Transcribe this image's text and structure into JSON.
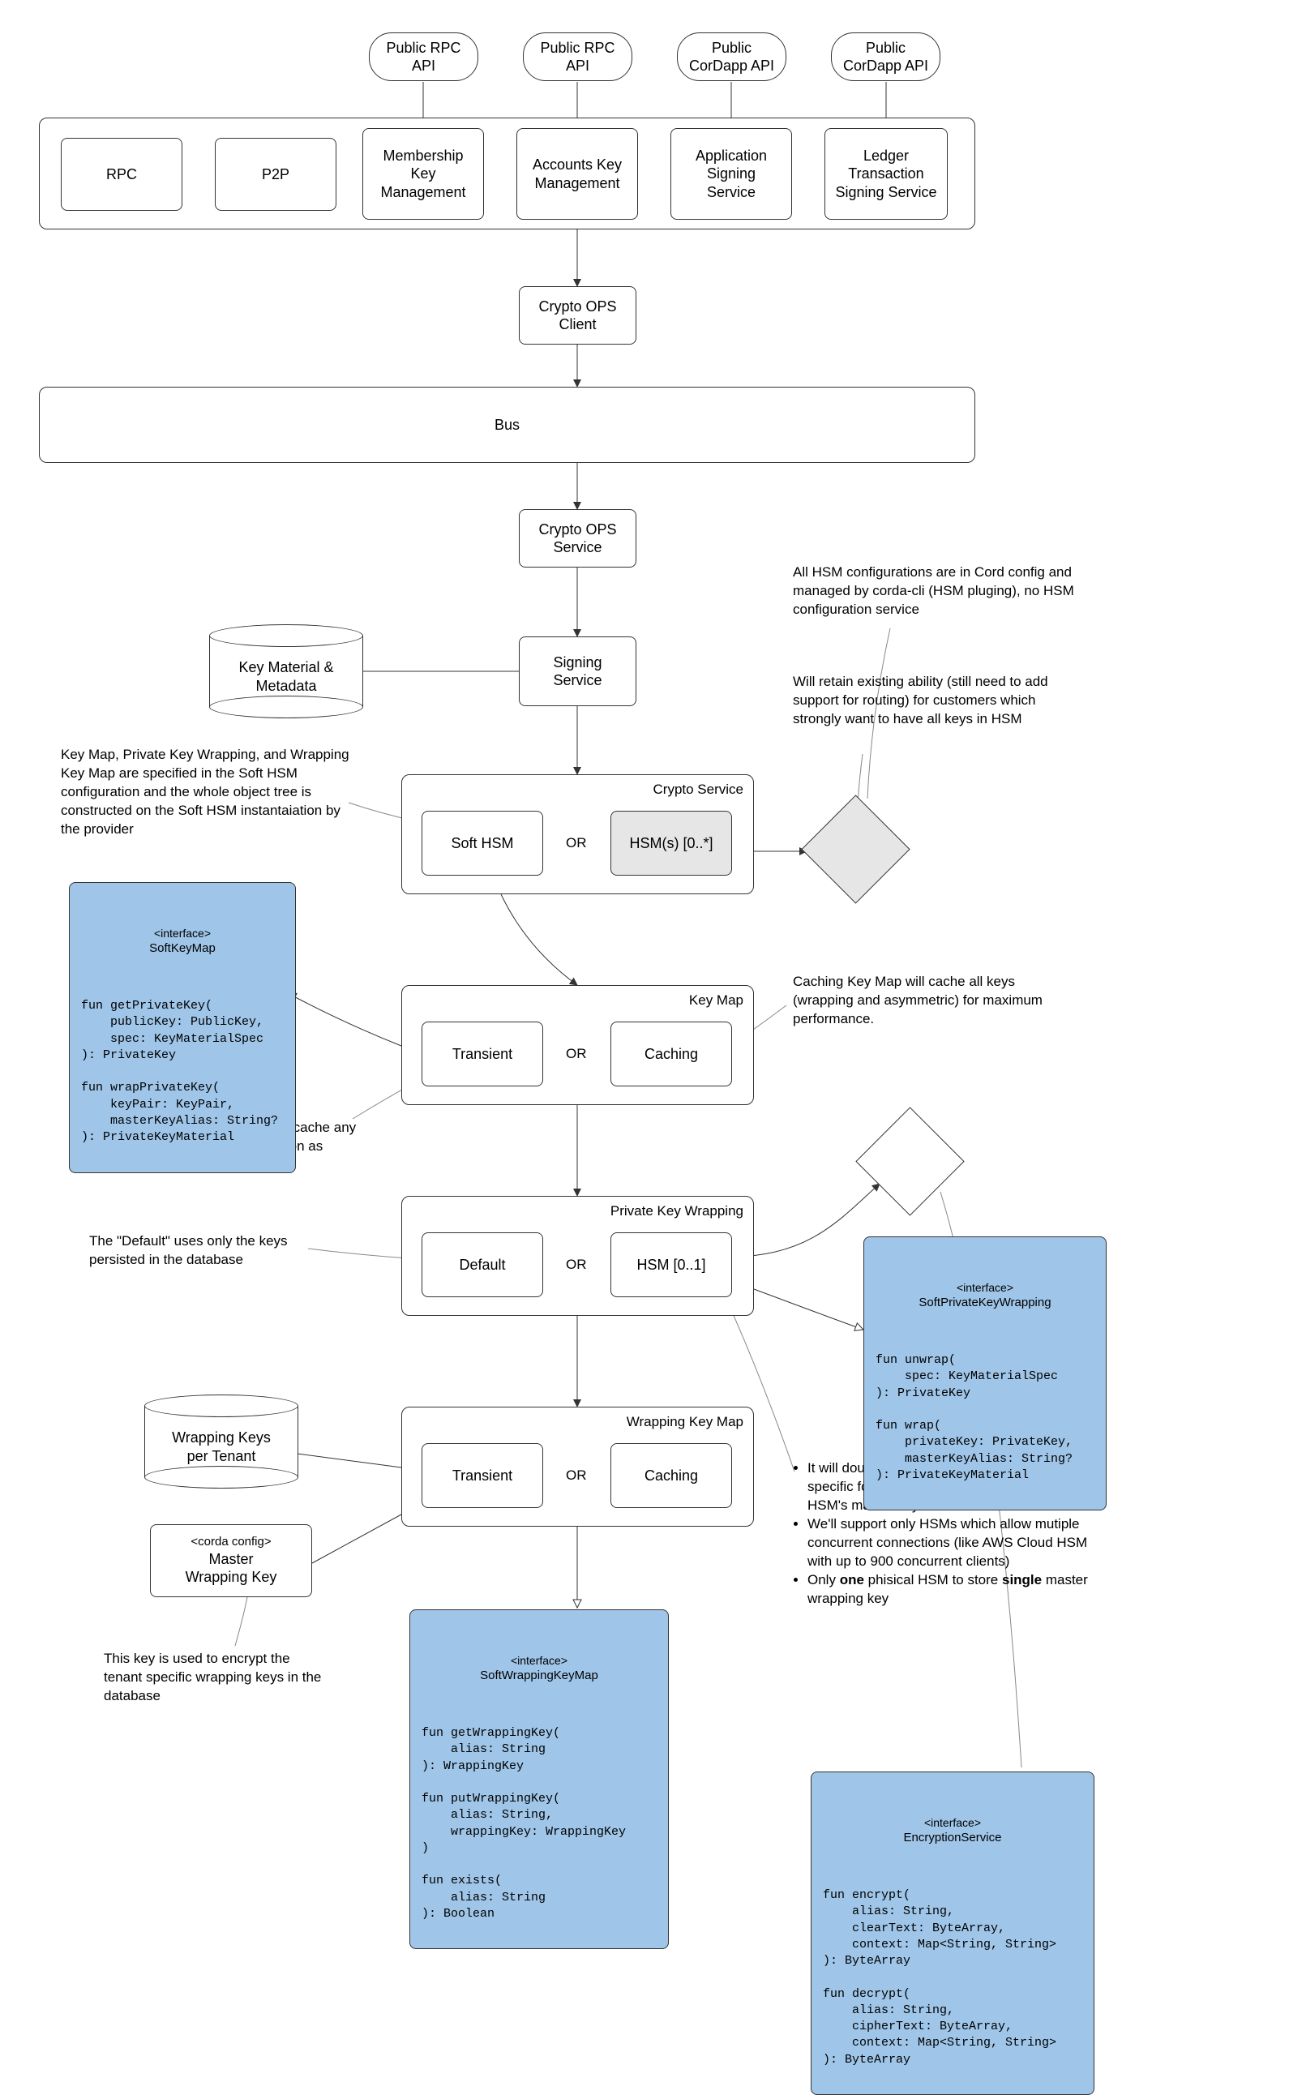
{
  "top_apis": {
    "rpc1": "Public RPC\nAPI",
    "rpc2": "Public RPC\nAPI",
    "cordapp1": "Public\nCorDapp API",
    "cordapp2": "Public\nCorDapp API"
  },
  "top_services": {
    "rpc": "RPC",
    "p2p": "P2P",
    "mkm": "Membership\nKey\nManagement",
    "akm": "Accounts Key\nManagement",
    "ass": "Application\nSigning\nService",
    "ltss": "Ledger\nTransaction\nSigning Service"
  },
  "mid": {
    "ops_client": "Crypto OPS\nClient",
    "bus": "Bus",
    "ops_service": "Crypto OPS\nService",
    "signing": "Signing\nService",
    "km_cyl": "Key Material &\nMetadata"
  },
  "groups": {
    "crypto_service": {
      "label": "Crypto Service",
      "left": "Soft HSM",
      "right": "HSM(s) [0..*]",
      "or": "OR"
    },
    "key_map": {
      "label": "Key Map",
      "left": "Transient",
      "right": "Caching",
      "or": "OR"
    },
    "pkw": {
      "label": "Private Key Wrapping",
      "left": "Default",
      "right": "HSM [0..1]",
      "or": "OR"
    },
    "wkm": {
      "label": "Wrapping Key Map",
      "left": "Transient",
      "right": "Caching",
      "or": "OR"
    }
  },
  "cylinders": {
    "wrapping_keys": "Wrapping Keys\nper Tenant",
    "master_key_stereo": "<corda config>",
    "master_key": "Master\nWrapping Key"
  },
  "annotations": {
    "hsm_config": "All HSM configurations are in Cord config and managed by corda-cli (HSM pluging), no HSM configuration service",
    "retain": "Will retain existing ability (still need to add support for routing) for customers which strongly want to have all keys in HSM",
    "soft_hsm_cfg": "Key Map, Private Key Wrapping, and Wrapping Key Map are specified in the Soft HSM configuration and the whole object tree is constructed on the Soft HSM instantaiation by the provider",
    "caching_keymap": "Caching Key Map will cache all keys (wrapping and asymmetric) for maximum performance.",
    "transient_note": "Transient implementation will not cache any keys, they will be disposed as soon as possible and is the default setting.",
    "default_note": "The \"Default\" uses only the keys persisted in the database",
    "master_key_note": "This key is used to encrypt the tenant specific wrapping keys in the database",
    "bullets_1": "It will double encryp the keys - first by tenant specific form the database and second by the HSM's master key",
    "bullets_2": "We'll support only HSMs which allow mutiple concurrent connections (like AWS Cloud HSM with up to 900 concurrent clients)",
    "bullets_3_a": "Only ",
    "bullets_3_b": "one",
    "bullets_3_c": " phisical HSM to store ",
    "bullets_3_d": "single",
    "bullets_3_e": " master wrapping key"
  },
  "interfaces": {
    "soft_key_map": {
      "stereo": "<interface>",
      "name": "SoftKeyMap",
      "code": "fun getPrivateKey(\n    publicKey: PublicKey,\n    spec: KeyMaterialSpec\n): PrivateKey\n\nfun wrapPrivateKey(\n    keyPair: KeyPair,\n    masterKeyAlias: String?\n): PrivateKeyMaterial"
    },
    "soft_pkw": {
      "stereo": "<interface>",
      "name": "SoftPrivateKeyWrapping",
      "code": "fun unwrap(\n    spec: KeyMaterialSpec\n): PrivateKey\n\nfun wrap(\n    privateKey: PrivateKey,\n    masterKeyAlias: String?\n): PrivateKeyMaterial"
    },
    "soft_wkm": {
      "stereo": "<interface>",
      "name": "SoftWrappingKeyMap",
      "code": "fun getWrappingKey(\n    alias: String\n): WrappingKey\n\nfun putWrappingKey(\n    alias: String,\n    wrappingKey: WrappingKey\n)\n\nfun exists(\n    alias: String\n): Boolean"
    },
    "enc_service": {
      "stereo": "<interface>",
      "name": "EncryptionService",
      "code": "fun encrypt(\n    alias: String,\n    clearText: ByteArray,\n    context: Map<String, String>\n): ByteArray\n\nfun decrypt(\n    alias: String,\n    cipherText: ByteArray,\n    context: Map<String, String>\n): ByteArray"
    }
  }
}
